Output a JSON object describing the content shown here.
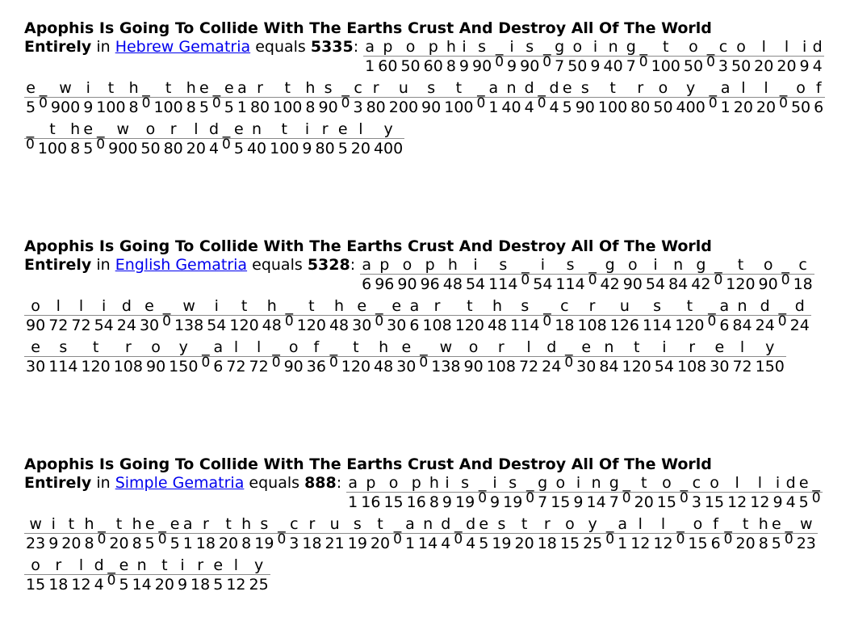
{
  "phrase": "Apophis Is Going To Collide With The Earths Crust And Destroy All Of The World Entirely",
  "heading_main": "Apophis Is Going To Collide With The Earths Crust And Destroy All Of The World",
  "heading_tail": "Entirely",
  "connector_in": "in",
  "connector_equals": "equals",
  "colon": ":",
  "space_char": "_",
  "letters": "apophis_is_going_to_collide_with_the_earths_crust_and_destroy_all_of_the_world_entirely",
  "blocks": [
    {
      "cipher": "Hebrew Gematria",
      "total": "5335",
      "values": [
        "1",
        "60",
        "50",
        "60",
        "8",
        "9",
        "90",
        "0",
        "9",
        "90",
        "0",
        "7",
        "50",
        "9",
        "40",
        "7",
        "0",
        "100",
        "50",
        "0",
        "3",
        "50",
        "20",
        "20",
        "9",
        "4",
        "5",
        "0",
        "900",
        "9",
        "100",
        "8",
        "0",
        "100",
        "8",
        "5",
        "0",
        "5",
        "1",
        "80",
        "100",
        "8",
        "90",
        "0",
        "3",
        "80",
        "200",
        "90",
        "100",
        "0",
        "1",
        "40",
        "4",
        "0",
        "4",
        "5",
        "90",
        "100",
        "80",
        "50",
        "400",
        "0",
        "1",
        "20",
        "20",
        "0",
        "50",
        "6",
        "0",
        "100",
        "8",
        "5",
        "0",
        "900",
        "50",
        "80",
        "20",
        "4",
        "0",
        "5",
        "40",
        "100",
        "9",
        "80",
        "5",
        "20",
        "400"
      ]
    },
    {
      "cipher": "English Gematria",
      "total": "5328",
      "values": [
        "6",
        "96",
        "90",
        "96",
        "48",
        "54",
        "114",
        "0",
        "54",
        "114",
        "0",
        "42",
        "90",
        "54",
        "84",
        "42",
        "0",
        "120",
        "90",
        "0",
        "18",
        "90",
        "72",
        "72",
        "54",
        "24",
        "30",
        "0",
        "138",
        "54",
        "120",
        "48",
        "0",
        "120",
        "48",
        "30",
        "0",
        "30",
        "6",
        "108",
        "120",
        "48",
        "114",
        "0",
        "18",
        "108",
        "126",
        "114",
        "120",
        "0",
        "6",
        "84",
        "24",
        "0",
        "24",
        "30",
        "114",
        "120",
        "108",
        "90",
        "150",
        "0",
        "6",
        "72",
        "72",
        "0",
        "90",
        "36",
        "0",
        "120",
        "48",
        "30",
        "0",
        "138",
        "90",
        "108",
        "72",
        "24",
        "0",
        "30",
        "84",
        "120",
        "54",
        "108",
        "30",
        "72",
        "150"
      ]
    },
    {
      "cipher": "Simple Gematria",
      "total": "888",
      "values": [
        "1",
        "16",
        "15",
        "16",
        "8",
        "9",
        "19",
        "0",
        "9",
        "19",
        "0",
        "7",
        "15",
        "9",
        "14",
        "7",
        "0",
        "20",
        "15",
        "0",
        "3",
        "15",
        "12",
        "12",
        "9",
        "4",
        "5",
        "0",
        "23",
        "9",
        "20",
        "8",
        "0",
        "20",
        "8",
        "5",
        "0",
        "5",
        "1",
        "18",
        "20",
        "8",
        "19",
        "0",
        "3",
        "18",
        "21",
        "19",
        "20",
        "0",
        "1",
        "14",
        "4",
        "0",
        "4",
        "5",
        "19",
        "20",
        "18",
        "15",
        "25",
        "0",
        "1",
        "12",
        "12",
        "0",
        "15",
        "6",
        "0",
        "20",
        "8",
        "5",
        "0",
        "23",
        "15",
        "18",
        "12",
        "4",
        "0",
        "5",
        "14",
        "20",
        "9",
        "18",
        "5",
        "12",
        "25"
      ]
    }
  ]
}
